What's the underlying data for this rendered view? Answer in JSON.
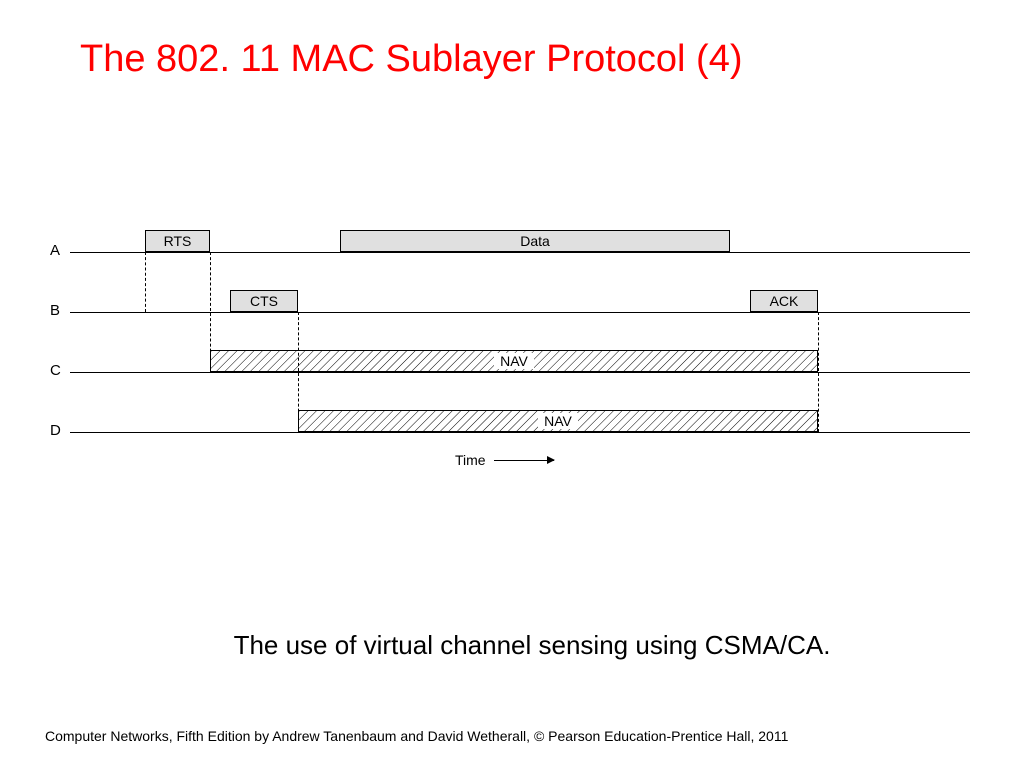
{
  "title": "The 802. 11 MAC Sublayer Protocol (4)",
  "caption": "The use of virtual channel sensing using CSMA/CA.",
  "footer": "Computer Networks, Fifth Edition by Andrew Tanenbaum and David Wetherall, © Pearson Education-Prentice Hall, 2011",
  "rows": {
    "A": "A",
    "B": "B",
    "C": "C",
    "D": "D"
  },
  "packets": {
    "rts": "RTS",
    "cts": "CTS",
    "data": "Data",
    "ack": "ACK",
    "navC": "NAV",
    "navD": "NAV"
  },
  "time_label": "Time",
  "chart_data": {
    "type": "timeline",
    "rows": [
      "A",
      "B",
      "C",
      "D"
    ],
    "events": [
      {
        "row": "A",
        "label": "RTS",
        "start": 95,
        "end": 160,
        "kind": "frame"
      },
      {
        "row": "A",
        "label": "Data",
        "start": 290,
        "end": 680,
        "kind": "frame"
      },
      {
        "row": "B",
        "label": "CTS",
        "start": 180,
        "end": 248,
        "kind": "frame"
      },
      {
        "row": "B",
        "label": "ACK",
        "start": 700,
        "end": 768,
        "kind": "frame"
      },
      {
        "row": "C",
        "label": "NAV",
        "start": 160,
        "end": 768,
        "kind": "nav"
      },
      {
        "row": "D",
        "label": "NAV",
        "start": 248,
        "end": 768,
        "kind": "nav"
      }
    ],
    "dashed_markers": [
      95,
      160,
      248,
      768
    ],
    "time_axis_label": "Time"
  }
}
